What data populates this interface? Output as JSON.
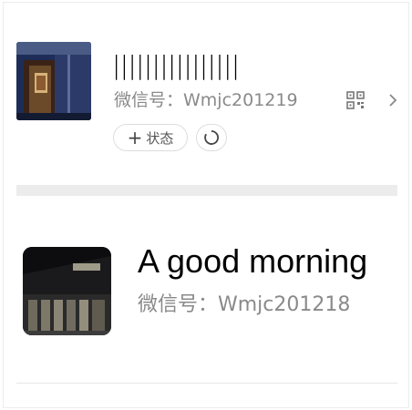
{
  "profile_card": {
    "name": "||||||||||||||||",
    "wechat_id": "微信号：Wmjc201219",
    "status_button_label": "状态",
    "status_button_plus": "+",
    "icons": {
      "qr": "qr-code-icon",
      "chevron": "chevron-right-icon",
      "loading": "loading-circle-icon"
    }
  },
  "second_profile": {
    "name": "A  good morning",
    "wechat_id": "微信号：Wmjc201218"
  },
  "colors": {
    "secondary_text": "#8a8a8a",
    "divider": "#ececec"
  }
}
